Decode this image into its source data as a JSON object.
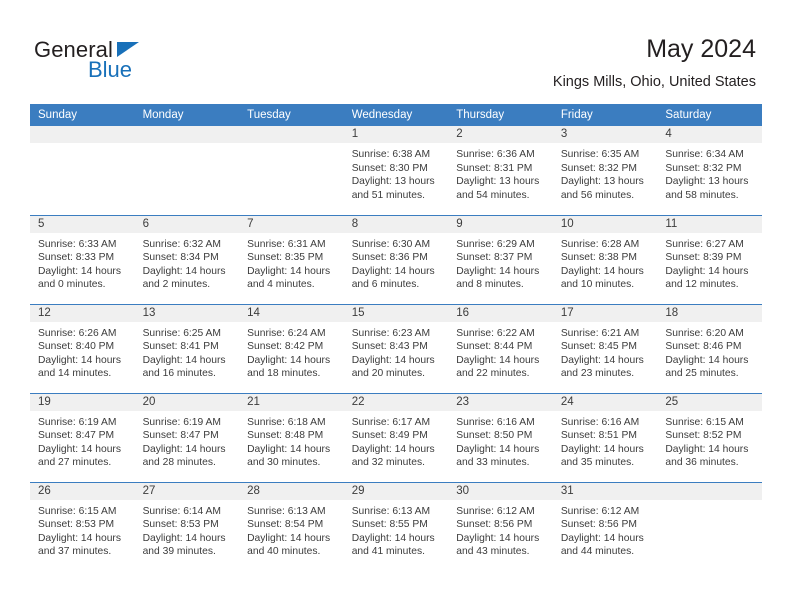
{
  "brand": {
    "name_part1": "General",
    "name_part2": "Blue",
    "logo_icon": "triangle-icon",
    "accent_color": "#1870b9"
  },
  "header": {
    "title": "May 2024",
    "location": "Kings Mills, Ohio, United States"
  },
  "colors": {
    "header_blue": "#3b7dc0",
    "daynum_band": "#f0f0f0",
    "text": "#3c3c3c"
  },
  "weekday_headers": [
    "Sunday",
    "Monday",
    "Tuesday",
    "Wednesday",
    "Thursday",
    "Friday",
    "Saturday"
  ],
  "labels": {
    "sunrise_prefix": "Sunrise:",
    "sunset_prefix": "Sunset:",
    "daylight_prefix": "Daylight:"
  },
  "weeks": [
    [
      {
        "blank": true,
        "day": ""
      },
      {
        "blank": true,
        "day": ""
      },
      {
        "blank": true,
        "day": ""
      },
      {
        "day": "1",
        "sunrise": "Sunrise: 6:38 AM",
        "sunset": "Sunset: 8:30 PM",
        "daylight_line1": "Daylight: 13 hours",
        "daylight_line2": "and 51 minutes."
      },
      {
        "day": "2",
        "sunrise": "Sunrise: 6:36 AM",
        "sunset": "Sunset: 8:31 PM",
        "daylight_line1": "Daylight: 13 hours",
        "daylight_line2": "and 54 minutes."
      },
      {
        "day": "3",
        "sunrise": "Sunrise: 6:35 AM",
        "sunset": "Sunset: 8:32 PM",
        "daylight_line1": "Daylight: 13 hours",
        "daylight_line2": "and 56 minutes."
      },
      {
        "day": "4",
        "sunrise": "Sunrise: 6:34 AM",
        "sunset": "Sunset: 8:32 PM",
        "daylight_line1": "Daylight: 13 hours",
        "daylight_line2": "and 58 minutes."
      }
    ],
    [
      {
        "day": "5",
        "sunrise": "Sunrise: 6:33 AM",
        "sunset": "Sunset: 8:33 PM",
        "daylight_line1": "Daylight: 14 hours",
        "daylight_line2": "and 0 minutes."
      },
      {
        "day": "6",
        "sunrise": "Sunrise: 6:32 AM",
        "sunset": "Sunset: 8:34 PM",
        "daylight_line1": "Daylight: 14 hours",
        "daylight_line2": "and 2 minutes."
      },
      {
        "day": "7",
        "sunrise": "Sunrise: 6:31 AM",
        "sunset": "Sunset: 8:35 PM",
        "daylight_line1": "Daylight: 14 hours",
        "daylight_line2": "and 4 minutes."
      },
      {
        "day": "8",
        "sunrise": "Sunrise: 6:30 AM",
        "sunset": "Sunset: 8:36 PM",
        "daylight_line1": "Daylight: 14 hours",
        "daylight_line2": "and 6 minutes."
      },
      {
        "day": "9",
        "sunrise": "Sunrise: 6:29 AM",
        "sunset": "Sunset: 8:37 PM",
        "daylight_line1": "Daylight: 14 hours",
        "daylight_line2": "and 8 minutes."
      },
      {
        "day": "10",
        "sunrise": "Sunrise: 6:28 AM",
        "sunset": "Sunset: 8:38 PM",
        "daylight_line1": "Daylight: 14 hours",
        "daylight_line2": "and 10 minutes."
      },
      {
        "day": "11",
        "sunrise": "Sunrise: 6:27 AM",
        "sunset": "Sunset: 8:39 PM",
        "daylight_line1": "Daylight: 14 hours",
        "daylight_line2": "and 12 minutes."
      }
    ],
    [
      {
        "day": "12",
        "sunrise": "Sunrise: 6:26 AM",
        "sunset": "Sunset: 8:40 PM",
        "daylight_line1": "Daylight: 14 hours",
        "daylight_line2": "and 14 minutes."
      },
      {
        "day": "13",
        "sunrise": "Sunrise: 6:25 AM",
        "sunset": "Sunset: 8:41 PM",
        "daylight_line1": "Daylight: 14 hours",
        "daylight_line2": "and 16 minutes."
      },
      {
        "day": "14",
        "sunrise": "Sunrise: 6:24 AM",
        "sunset": "Sunset: 8:42 PM",
        "daylight_line1": "Daylight: 14 hours",
        "daylight_line2": "and 18 minutes."
      },
      {
        "day": "15",
        "sunrise": "Sunrise: 6:23 AM",
        "sunset": "Sunset: 8:43 PM",
        "daylight_line1": "Daylight: 14 hours",
        "daylight_line2": "and 20 minutes."
      },
      {
        "day": "16",
        "sunrise": "Sunrise: 6:22 AM",
        "sunset": "Sunset: 8:44 PM",
        "daylight_line1": "Daylight: 14 hours",
        "daylight_line2": "and 22 minutes."
      },
      {
        "day": "17",
        "sunrise": "Sunrise: 6:21 AM",
        "sunset": "Sunset: 8:45 PM",
        "daylight_line1": "Daylight: 14 hours",
        "daylight_line2": "and 23 minutes."
      },
      {
        "day": "18",
        "sunrise": "Sunrise: 6:20 AM",
        "sunset": "Sunset: 8:46 PM",
        "daylight_line1": "Daylight: 14 hours",
        "daylight_line2": "and 25 minutes."
      }
    ],
    [
      {
        "day": "19",
        "sunrise": "Sunrise: 6:19 AM",
        "sunset": "Sunset: 8:47 PM",
        "daylight_line1": "Daylight: 14 hours",
        "daylight_line2": "and 27 minutes."
      },
      {
        "day": "20",
        "sunrise": "Sunrise: 6:19 AM",
        "sunset": "Sunset: 8:47 PM",
        "daylight_line1": "Daylight: 14 hours",
        "daylight_line2": "and 28 minutes."
      },
      {
        "day": "21",
        "sunrise": "Sunrise: 6:18 AM",
        "sunset": "Sunset: 8:48 PM",
        "daylight_line1": "Daylight: 14 hours",
        "daylight_line2": "and 30 minutes."
      },
      {
        "day": "22",
        "sunrise": "Sunrise: 6:17 AM",
        "sunset": "Sunset: 8:49 PM",
        "daylight_line1": "Daylight: 14 hours",
        "daylight_line2": "and 32 minutes."
      },
      {
        "day": "23",
        "sunrise": "Sunrise: 6:16 AM",
        "sunset": "Sunset: 8:50 PM",
        "daylight_line1": "Daylight: 14 hours",
        "daylight_line2": "and 33 minutes."
      },
      {
        "day": "24",
        "sunrise": "Sunrise: 6:16 AM",
        "sunset": "Sunset: 8:51 PM",
        "daylight_line1": "Daylight: 14 hours",
        "daylight_line2": "and 35 minutes."
      },
      {
        "day": "25",
        "sunrise": "Sunrise: 6:15 AM",
        "sunset": "Sunset: 8:52 PM",
        "daylight_line1": "Daylight: 14 hours",
        "daylight_line2": "and 36 minutes."
      }
    ],
    [
      {
        "day": "26",
        "sunrise": "Sunrise: 6:15 AM",
        "sunset": "Sunset: 8:53 PM",
        "daylight_line1": "Daylight: 14 hours",
        "daylight_line2": "and 37 minutes."
      },
      {
        "day": "27",
        "sunrise": "Sunrise: 6:14 AM",
        "sunset": "Sunset: 8:53 PM",
        "daylight_line1": "Daylight: 14 hours",
        "daylight_line2": "and 39 minutes."
      },
      {
        "day": "28",
        "sunrise": "Sunrise: 6:13 AM",
        "sunset": "Sunset: 8:54 PM",
        "daylight_line1": "Daylight: 14 hours",
        "daylight_line2": "and 40 minutes."
      },
      {
        "day": "29",
        "sunrise": "Sunrise: 6:13 AM",
        "sunset": "Sunset: 8:55 PM",
        "daylight_line1": "Daylight: 14 hours",
        "daylight_line2": "and 41 minutes."
      },
      {
        "day": "30",
        "sunrise": "Sunrise: 6:12 AM",
        "sunset": "Sunset: 8:56 PM",
        "daylight_line1": "Daylight: 14 hours",
        "daylight_line2": "and 43 minutes."
      },
      {
        "day": "31",
        "sunrise": "Sunrise: 6:12 AM",
        "sunset": "Sunset: 8:56 PM",
        "daylight_line1": "Daylight: 14 hours",
        "daylight_line2": "and 44 minutes."
      },
      {
        "blank": true,
        "day": ""
      }
    ]
  ]
}
